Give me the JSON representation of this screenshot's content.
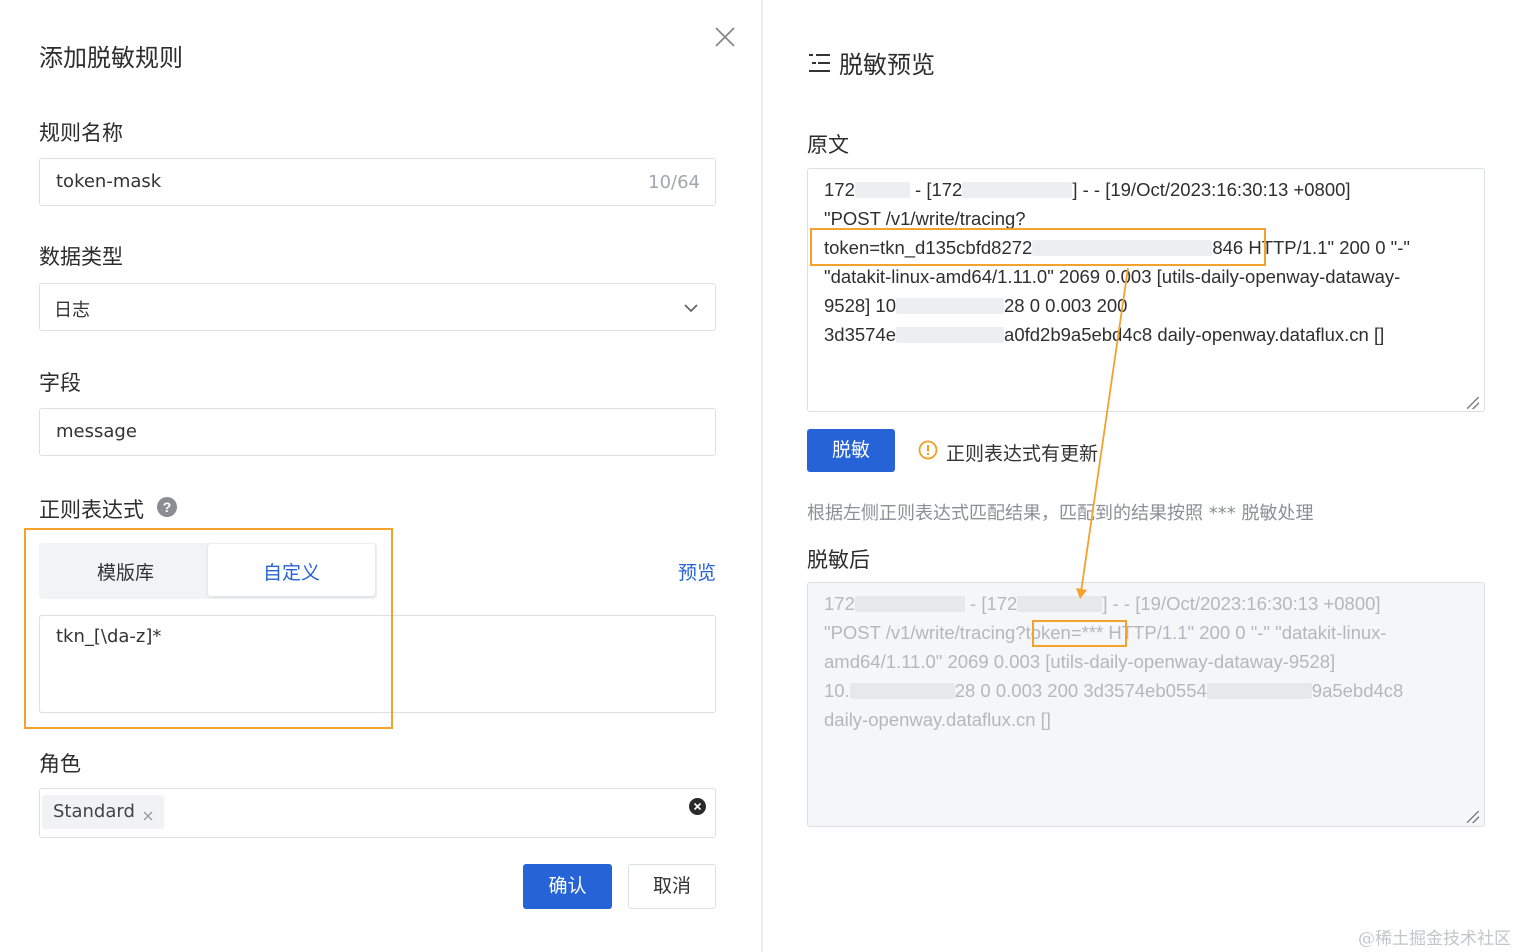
{
  "left": {
    "title": "添加脱敏规则",
    "close_icon": "close-icon",
    "rule_name": {
      "label": "规则名称",
      "value": "token-mask",
      "counter": "10/64"
    },
    "data_type": {
      "label": "数据类型",
      "value": "日志",
      "icon": "chevron-down-icon"
    },
    "field": {
      "label": "字段",
      "value": "message"
    },
    "regex": {
      "label": "正则表达式",
      "help_icon": "question-circle-icon",
      "tabs": [
        "模版库",
        "自定义"
      ],
      "active_tab": "自定义",
      "preview_link": "预览",
      "value": "tkn_[\\da-z]*"
    },
    "role": {
      "label": "角色",
      "tag": "Standard",
      "clear_icon": "clear-circle-icon"
    },
    "confirm": "确认",
    "cancel": "取消"
  },
  "right": {
    "title": "脱敏预览",
    "title_icon": "list-icon",
    "original": {
      "label": "原文",
      "line1": {
        "a": "172",
        "b": " - [172",
        "c": "] - - [19/Oct/2023:16:30:13 +0800]"
      },
      "line2": "\"POST /v1/write/tracing?",
      "line3": {
        "a": "token=tkn_d135cbfd8272",
        "b": "846",
        "c": " HTTP/1.1\" 200 0 \"-\""
      },
      "line4": "\"datakit-linux-amd64/1.11.0\" 2069 0.003 [utils-daily-openway-dataway-",
      "line5": {
        "a": "9528] 10",
        "b": "28 0 0.003 200"
      },
      "line6": {
        "a": "3d3574e",
        "b": "a0fd2b9a5ebd4c8 daily-openway.dataflux.cn []"
      }
    },
    "mask_button": "脱敏",
    "update_notice": "正则表达式有更新",
    "warning_icon": "warning-circle-icon",
    "hint": "根据左侧正则表达式匹配结果，匹配到的结果按照 *** 脱敏处理",
    "masked": {
      "label": "脱敏后",
      "line1": {
        "a": "172",
        "b": " - [172",
        "c": "] - - [19/Oct/2023:16:30:13 +0800]"
      },
      "line2": {
        "a": "\"POST /v1/write/tracing?",
        "b": "token=***",
        "c": " HTTP/1.1\" 200 0 \"-\" \"datakit-linux-"
      },
      "line3": "amd64/1.11.0\" 2069 0.003 [utils-daily-openway-dataway-9528]",
      "line4": {
        "a": "10.",
        "b": "28 0 0.003 200 3d3574eb0554",
        "c": "9a5ebd4c8"
      },
      "line5": "daily-openway.dataflux.cn []"
    },
    "watermark": "@稀土掘金技术社区"
  },
  "colors": {
    "primary": "#2563d6",
    "highlight": "#f3a22d",
    "warning": "#f0a020",
    "link": "#2563d6"
  }
}
